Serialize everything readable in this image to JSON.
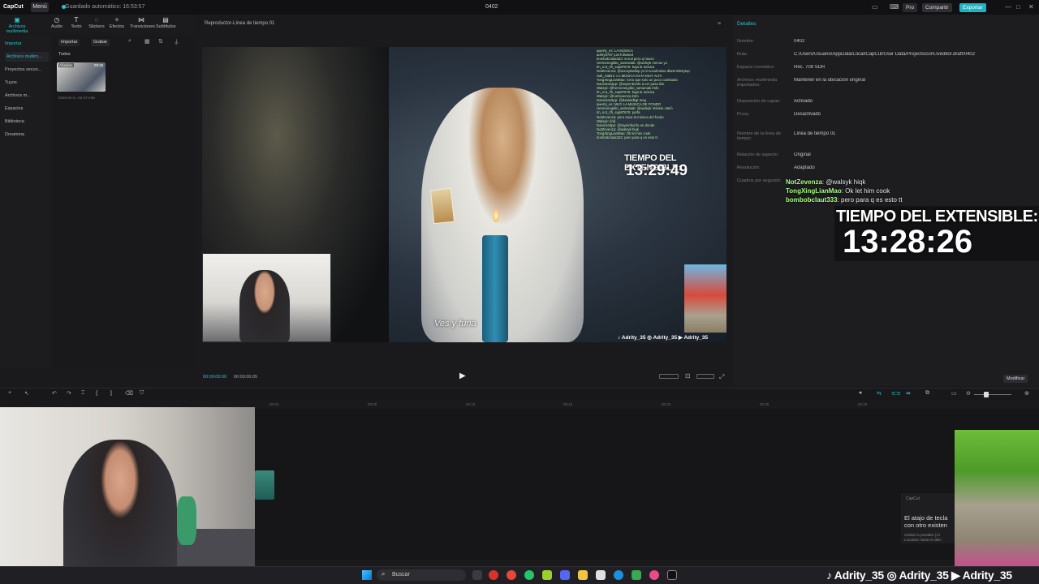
{
  "titlebar": {
    "logo": "CapCut",
    "menu": "Menú",
    "saved": "Guardado automático: 16:53:57",
    "project": "0402",
    "pro": "Pro",
    "share": "Compartir",
    "export": "Exportar"
  },
  "toolbar": {
    "tools": [
      "Archivos multimedia",
      "Audio",
      "Texto",
      "Stickers",
      "Efectos",
      "Transiciones",
      "Subtítulos"
    ]
  },
  "leftnav": {
    "items": [
      "Importar",
      "Archivos multim...",
      "Proyectos secun...",
      "Tuyos",
      "Archivos m...",
      "Espacios",
      "Biblioteca",
      "Dreamina"
    ]
  },
  "media": {
    "import": "Importar",
    "record": "Grabar",
    "all": "Todos",
    "thumb_added": "Añadido",
    "thumb_duration": "00:25",
    "thumb_name": "2026-04-0...02-27.mkv"
  },
  "player": {
    "title": "Reproductor-Línea de tiempo 01",
    "time_current": "00:00:00:00",
    "time_total": "00:00:06:05",
    "subtitle": "Ves y funa",
    "socials": "♪ Adrity_35  ◎ Adrity_35  ▶ Adrity_35"
  },
  "overlay_small": {
    "title": "TIEMPO DEL EXTENSIBLE:",
    "time": "13:29:49"
  },
  "overlay_big": {
    "title": "TIEMPO DEL EXTENSIBLE:",
    "time": "13:28:26"
  },
  "chat_video": [
    "qwerty_es: LA MÚSICA",
    "adrity9787 just followed",
    "bombobclaut333: srmal pero q hacen",
    "Hermenegildo_samaniak: @walsyk menos yo",
    "lm_not_rlh_sup87676: baja la música",
    "NotZevenza: @sucoylasltop yo lo tocolmolos dlaremilo9ytup",
    "Salt_Sabirs: LA MÚSICA ESTA MUY ALTA",
    "TongXingLianMao: Creo que solo un poco cambiado",
    "Daniviras3pp: @rayembonfo a ver pasa link",
    "Walsyk: @hermenegildo_samaniak lmfo",
    "lm_not_rlh_sup87676: baja la música",
    "Walsyk: @notzevenza lmfo",
    "Daniviras3pp: @danieldkgt meg",
    "qwerty_es: MUY LA MÚSICA DE FONDO",
    "Hermenegildo_samaniak: @walsyk Visítelo Uteló",
    "lm_not_rlh_sup87676: porfa",
    "NotZevenza: pero saca la música del fondo",
    "Walsyk: (lol)",
    "Danicira3pp: @rayembonfo en donde",
    "NotZevenza: @walsyk hiqk",
    "TongXingLianMao: Ok let him cook",
    "bombobclaut333: pero para q es esto tt"
  ],
  "details": {
    "tab": "Detalles",
    "rows": [
      {
        "label": "Nombre:",
        "value": "0402"
      },
      {
        "label": "Ruta:",
        "value": "C:/Users/Usuario/AppData/Local/CapCut/User Data/Projects/com.lveditor.draft/0402"
      },
      {
        "label": "Espacio cromático:",
        "value": "Rec. 709 SDR"
      },
      {
        "label": "Archivos multimedia importados:",
        "value": "Mantener en la ubicación original"
      },
      {
        "label": "Disposición de capas:",
        "value": "Activado"
      },
      {
        "label": "Proxy:",
        "value": "Desactivado"
      },
      {
        "label": "Nombre de la línea de tiempo:",
        "value": "Línea de tiempo 01"
      },
      {
        "label": "Relación de aspecto:",
        "value": "Original"
      },
      {
        "label": "Resolución:",
        "value": "Adaptado"
      },
      {
        "label": "Cuadros por segundo:",
        "value": ""
      }
    ],
    "modify": "Modificar"
  },
  "chat_side": [
    {
      "user": "NotZevenza",
      "text": ": @walsyk hiqk"
    },
    {
      "user": "TongXingLianMao",
      "text": ": Ok let him cook"
    },
    {
      "user": "bombobclaut333",
      "text": ": pero para q es esto tt"
    }
  ],
  "ruler": [
    "00:04",
    "00:08",
    "00:12",
    "00:16",
    "00:20",
    "00:25",
    "00:29"
  ],
  "toast": {
    "title": "CapCut",
    "text": "El atajo de tecla con otro existen",
    "small": "Grabar la pantalla: [Ct Localizar hasta el últim"
  },
  "taskbar": {
    "search": "Buscar"
  },
  "bottom_socials": "♪ Adrity_35  ◎ Adrity_35  ▶ Adrity_35",
  "colors": {
    "accent": "#1ec8cf",
    "chat_user": "#a6ff7e"
  }
}
